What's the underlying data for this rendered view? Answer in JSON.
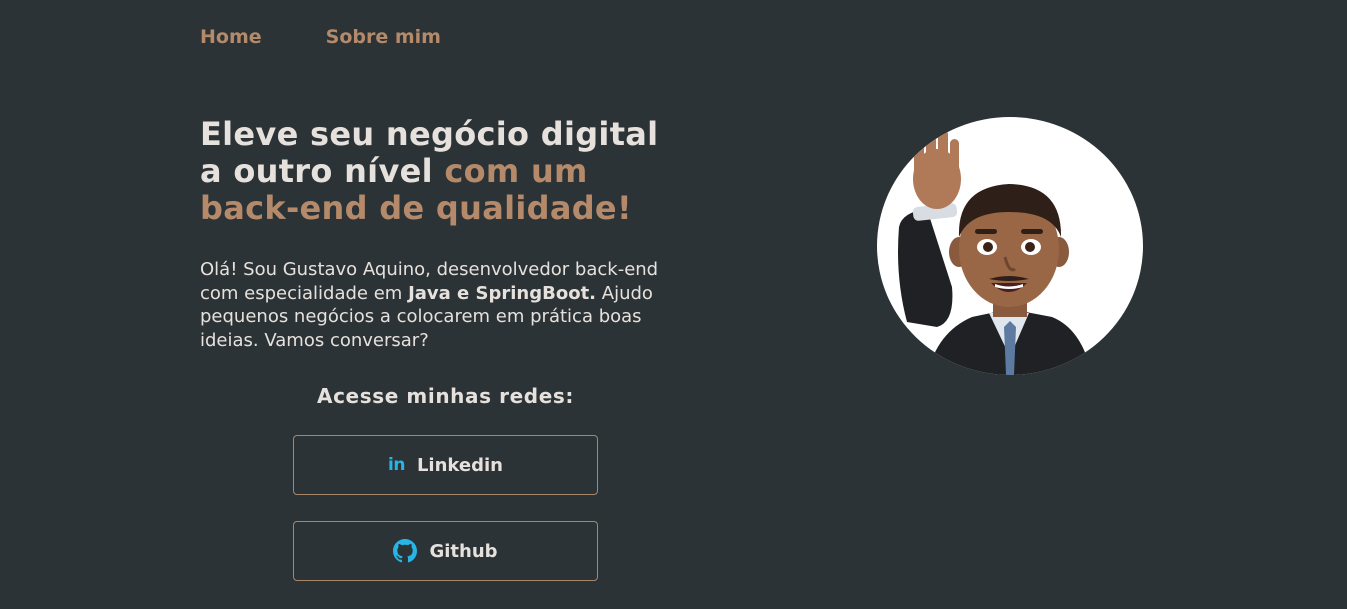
{
  "nav": {
    "home": "Home",
    "about": "Sobre mim"
  },
  "headline": {
    "line1": "Eleve seu negócio digital",
    "line2_plain": "a outro nível ",
    "line2_accent": "com um",
    "line3_accent": "back-end de qualidade!"
  },
  "intro": {
    "part1": "Olá! Sou Gustavo Aquino, desenvolvedor back-end com especialidade em ",
    "bold": "Java e SpringBoot.",
    "part2": " Ajudo pequenos negócios a colocarem em prática boas ideias. Vamos conversar?"
  },
  "social": {
    "title": "Acesse minhas redes:",
    "linkedin": {
      "label": "Linkedin",
      "icon": "linkedin-icon",
      "icon_glyph": "in"
    },
    "github": {
      "label": "Github",
      "icon": "github-icon"
    }
  },
  "avatar": {
    "icon": "memoji-avatar-waving"
  },
  "colors": {
    "background": "#2c3336",
    "accent": "#b48a6a",
    "text": "#e6e1dc",
    "button_border": "#a78769",
    "icon_blue": "#27b4e6"
  }
}
